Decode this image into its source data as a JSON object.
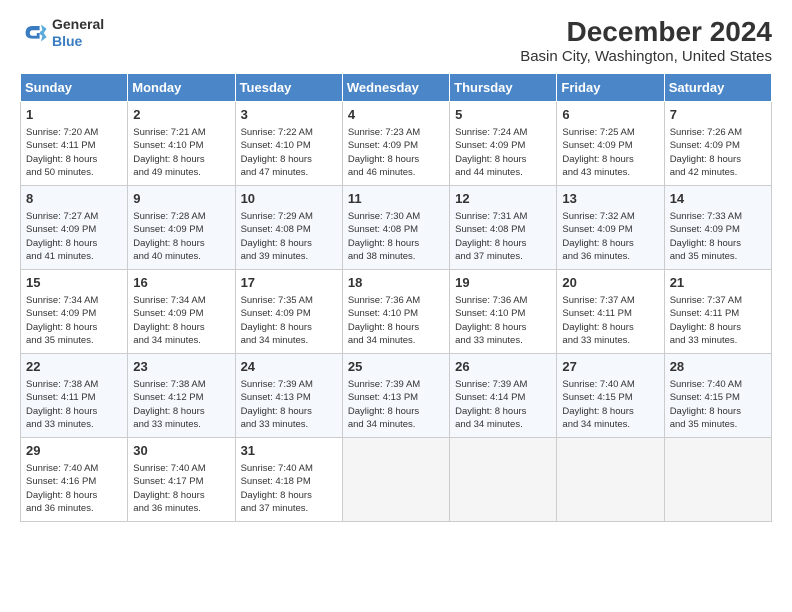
{
  "header": {
    "logo_general": "General",
    "logo_blue": "Blue",
    "title": "December 2024",
    "subtitle": "Basin City, Washington, United States"
  },
  "days_of_week": [
    "Sunday",
    "Monday",
    "Tuesday",
    "Wednesday",
    "Thursday",
    "Friday",
    "Saturday"
  ],
  "weeks": [
    [
      {
        "day": 1,
        "lines": [
          "Sunrise: 7:20 AM",
          "Sunset: 4:11 PM",
          "Daylight: 8 hours",
          "and 50 minutes."
        ]
      },
      {
        "day": 2,
        "lines": [
          "Sunrise: 7:21 AM",
          "Sunset: 4:10 PM",
          "Daylight: 8 hours",
          "and 49 minutes."
        ]
      },
      {
        "day": 3,
        "lines": [
          "Sunrise: 7:22 AM",
          "Sunset: 4:10 PM",
          "Daylight: 8 hours",
          "and 47 minutes."
        ]
      },
      {
        "day": 4,
        "lines": [
          "Sunrise: 7:23 AM",
          "Sunset: 4:09 PM",
          "Daylight: 8 hours",
          "and 46 minutes."
        ]
      },
      {
        "day": 5,
        "lines": [
          "Sunrise: 7:24 AM",
          "Sunset: 4:09 PM",
          "Daylight: 8 hours",
          "and 44 minutes."
        ]
      },
      {
        "day": 6,
        "lines": [
          "Sunrise: 7:25 AM",
          "Sunset: 4:09 PM",
          "Daylight: 8 hours",
          "and 43 minutes."
        ]
      },
      {
        "day": 7,
        "lines": [
          "Sunrise: 7:26 AM",
          "Sunset: 4:09 PM",
          "Daylight: 8 hours",
          "and 42 minutes."
        ]
      }
    ],
    [
      {
        "day": 8,
        "lines": [
          "Sunrise: 7:27 AM",
          "Sunset: 4:09 PM",
          "Daylight: 8 hours",
          "and 41 minutes."
        ]
      },
      {
        "day": 9,
        "lines": [
          "Sunrise: 7:28 AM",
          "Sunset: 4:09 PM",
          "Daylight: 8 hours",
          "and 40 minutes."
        ]
      },
      {
        "day": 10,
        "lines": [
          "Sunrise: 7:29 AM",
          "Sunset: 4:08 PM",
          "Daylight: 8 hours",
          "and 39 minutes."
        ]
      },
      {
        "day": 11,
        "lines": [
          "Sunrise: 7:30 AM",
          "Sunset: 4:08 PM",
          "Daylight: 8 hours",
          "and 38 minutes."
        ]
      },
      {
        "day": 12,
        "lines": [
          "Sunrise: 7:31 AM",
          "Sunset: 4:08 PM",
          "Daylight: 8 hours",
          "and 37 minutes."
        ]
      },
      {
        "day": 13,
        "lines": [
          "Sunrise: 7:32 AM",
          "Sunset: 4:09 PM",
          "Daylight: 8 hours",
          "and 36 minutes."
        ]
      },
      {
        "day": 14,
        "lines": [
          "Sunrise: 7:33 AM",
          "Sunset: 4:09 PM",
          "Daylight: 8 hours",
          "and 35 minutes."
        ]
      }
    ],
    [
      {
        "day": 15,
        "lines": [
          "Sunrise: 7:34 AM",
          "Sunset: 4:09 PM",
          "Daylight: 8 hours",
          "and 35 minutes."
        ]
      },
      {
        "day": 16,
        "lines": [
          "Sunrise: 7:34 AM",
          "Sunset: 4:09 PM",
          "Daylight: 8 hours",
          "and 34 minutes."
        ]
      },
      {
        "day": 17,
        "lines": [
          "Sunrise: 7:35 AM",
          "Sunset: 4:09 PM",
          "Daylight: 8 hours",
          "and 34 minutes."
        ]
      },
      {
        "day": 18,
        "lines": [
          "Sunrise: 7:36 AM",
          "Sunset: 4:10 PM",
          "Daylight: 8 hours",
          "and 34 minutes."
        ]
      },
      {
        "day": 19,
        "lines": [
          "Sunrise: 7:36 AM",
          "Sunset: 4:10 PM",
          "Daylight: 8 hours",
          "and 33 minutes."
        ]
      },
      {
        "day": 20,
        "lines": [
          "Sunrise: 7:37 AM",
          "Sunset: 4:11 PM",
          "Daylight: 8 hours",
          "and 33 minutes."
        ]
      },
      {
        "day": 21,
        "lines": [
          "Sunrise: 7:37 AM",
          "Sunset: 4:11 PM",
          "Daylight: 8 hours",
          "and 33 minutes."
        ]
      }
    ],
    [
      {
        "day": 22,
        "lines": [
          "Sunrise: 7:38 AM",
          "Sunset: 4:11 PM",
          "Daylight: 8 hours",
          "and 33 minutes."
        ]
      },
      {
        "day": 23,
        "lines": [
          "Sunrise: 7:38 AM",
          "Sunset: 4:12 PM",
          "Daylight: 8 hours",
          "and 33 minutes."
        ]
      },
      {
        "day": 24,
        "lines": [
          "Sunrise: 7:39 AM",
          "Sunset: 4:13 PM",
          "Daylight: 8 hours",
          "and 33 minutes."
        ]
      },
      {
        "day": 25,
        "lines": [
          "Sunrise: 7:39 AM",
          "Sunset: 4:13 PM",
          "Daylight: 8 hours",
          "and 34 minutes."
        ]
      },
      {
        "day": 26,
        "lines": [
          "Sunrise: 7:39 AM",
          "Sunset: 4:14 PM",
          "Daylight: 8 hours",
          "and 34 minutes."
        ]
      },
      {
        "day": 27,
        "lines": [
          "Sunrise: 7:40 AM",
          "Sunset: 4:15 PM",
          "Daylight: 8 hours",
          "and 34 minutes."
        ]
      },
      {
        "day": 28,
        "lines": [
          "Sunrise: 7:40 AM",
          "Sunset: 4:15 PM",
          "Daylight: 8 hours",
          "and 35 minutes."
        ]
      }
    ],
    [
      {
        "day": 29,
        "lines": [
          "Sunrise: 7:40 AM",
          "Sunset: 4:16 PM",
          "Daylight: 8 hours",
          "and 36 minutes."
        ]
      },
      {
        "day": 30,
        "lines": [
          "Sunrise: 7:40 AM",
          "Sunset: 4:17 PM",
          "Daylight: 8 hours",
          "and 36 minutes."
        ]
      },
      {
        "day": 31,
        "lines": [
          "Sunrise: 7:40 AM",
          "Sunset: 4:18 PM",
          "Daylight: 8 hours",
          "and 37 minutes."
        ]
      },
      null,
      null,
      null,
      null
    ]
  ]
}
